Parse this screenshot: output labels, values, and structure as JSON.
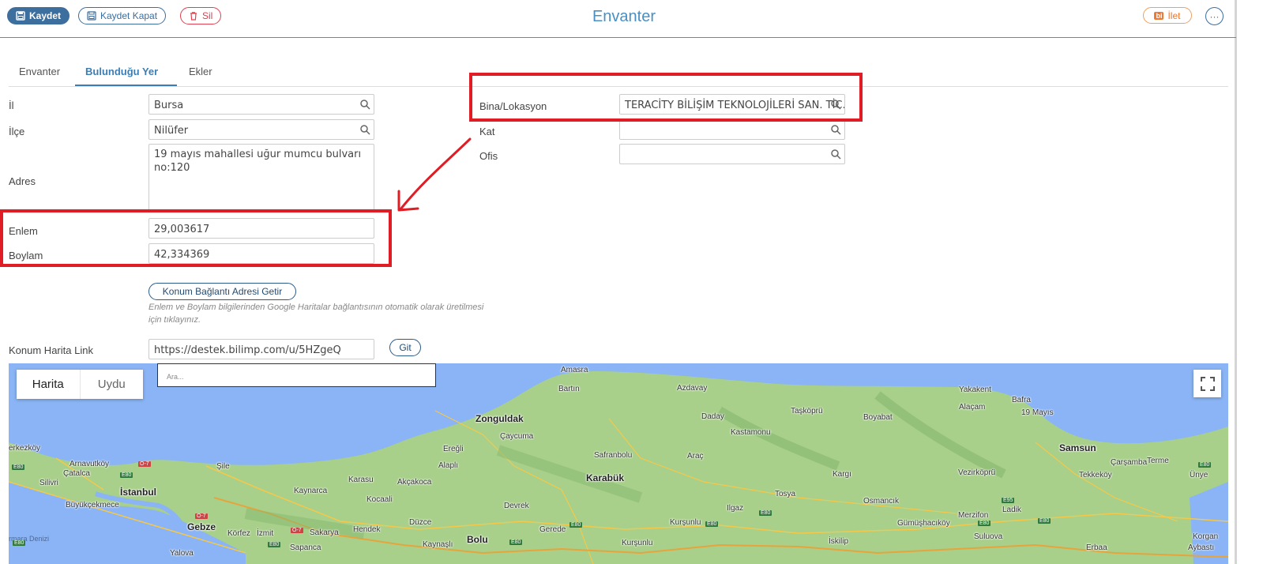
{
  "toolbar": {
    "save_label": "Kaydet",
    "save_close_label": "Kaydet Kapat",
    "delete_label": "Sil",
    "title": "Envanter",
    "forward_badge": "bi",
    "forward_label": "İlet",
    "more_label": "···"
  },
  "tabs": [
    {
      "label": "Envanter",
      "active": false
    },
    {
      "label": "Bulunduğu Yer",
      "active": true
    },
    {
      "label": "Ekler",
      "active": false
    }
  ],
  "form": {
    "il": {
      "label": "İl",
      "value": "Bursa"
    },
    "ilce": {
      "label": "İlçe",
      "value": "Nilüfer"
    },
    "adres": {
      "label": "Adres",
      "value": "19 mayıs mahallesi uğur mumcu bulvarı no:120"
    },
    "enlem": {
      "label": "Enlem",
      "value": "29,003617"
    },
    "boylam": {
      "label": "Boylam",
      "value": "42,334369"
    },
    "konum_button": "Konum Bağlantı Adresi Getir",
    "konum_hint": "Enlem ve Boylam bilgilerinden Google Haritalar bağlantısının otomatik olarak üretilmesi için tıklayınız.",
    "harita_link": {
      "label": "Konum Harita Link",
      "value": "https://destek.bilimp.com/u/5HZgeQ"
    },
    "git_button": "Git",
    "bina": {
      "label": "Bina/Lokasyon",
      "value": "TERACİTY BİLİŞİM TEKNOLOJİLERİ SAN. TİC. A.Ş."
    },
    "kat": {
      "label": "Kat",
      "value": ""
    },
    "ofis": {
      "label": "Ofis",
      "value": ""
    }
  },
  "map": {
    "type_options": [
      "Harita",
      "Uydu"
    ],
    "active_type": "Harita",
    "search_placeholder": "Ara...",
    "places": {
      "amasra": "Amasra",
      "bartin": "Bartın",
      "azdavay": "Azdavay",
      "zonguldak": "Zonguldak",
      "caycuma": "Çaycuma",
      "daday": "Daday",
      "kastamonu": "Kastamonu",
      "taskopru": "Taşköprü",
      "boyabat": "Boyabat",
      "yakakent": "Yakakent",
      "alacam": "Alaçam",
      "bafra": "Bafra",
      "ondokuz_mayis": "19 Mayıs",
      "samsun": "Samsun",
      "carsamba": "Çarşamba",
      "terme": "Terme",
      "tekkekoy": "Tekkeköy",
      "unye": "Ünye",
      "eregli": "Ereğli",
      "alapli": "Alaplı",
      "safranbolu": "Safranbolu",
      "arac": "Araç",
      "karabuk": "Karabük",
      "kargi": "Kargı",
      "vezirkopru": "Vezirköprü",
      "tosya": "Tosya",
      "osmancik": "Osmancık",
      "ladik": "Ladik",
      "kocaali": "Kocaali",
      "karasu": "Karasu",
      "akcakoca": "Akçakoca",
      "kaynarca": "Kaynarca",
      "sile": "Şile",
      "arnavutkoy": "Arnavutköy",
      "catalca": "Çatalca",
      "silivri": "Silivri",
      "istanbul": "İstanbul",
      "buyukcekmece": "Büyükçekmece",
      "kerkezkoy": "erkezköy",
      "gebze": "Gebze",
      "korfez": "Körfez",
      "izmit": "İzmit",
      "sakarya": "Sakarya",
      "hendek": "Hendek",
      "duzce": "Düzce",
      "devrek": "Devrek",
      "gerede": "Gerede",
      "bolu": "Bolu",
      "ilgaz": "Ilgaz",
      "kursunlu": "Kurşunlu",
      "merzifon": "Merzifon",
      "gumushacikoy": "Gümüşhacıköy",
      "marmara": "rmara Denizi",
      "sapanca": "Sapanca",
      "kaynasli": "Kaynaşlı",
      "yalova": "Yalova",
      "kursunlu2": "Kurşunlu",
      "iskilip": "İskilip",
      "suluova": "Suluova",
      "erbaa": "Erbaa",
      "korgan": "Korgan",
      "aybasti": "Aybastı"
    },
    "roads": [
      "E80",
      "O-7",
      "E95"
    ]
  },
  "colors": {
    "primary": "#3c6e9e",
    "danger": "#e04050",
    "accent": "#4a8fc4",
    "annotation_red": "#e01c24",
    "forward_orange": "#f07830"
  }
}
